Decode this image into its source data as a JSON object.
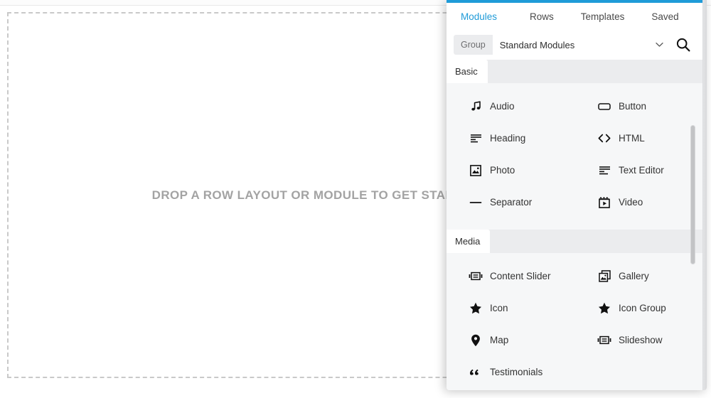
{
  "canvas": {
    "drop_text": "DROP A ROW LAYOUT OR MODULE TO GET STARTED"
  },
  "panel": {
    "accent_color": "#1f9bd8",
    "tabs": [
      {
        "label": "Modules",
        "active": true
      },
      {
        "label": "Rows",
        "active": false
      },
      {
        "label": "Templates",
        "active": false
      },
      {
        "label": "Saved",
        "active": false
      }
    ],
    "search": {
      "group_label": "Group",
      "selected_group": "Standard Modules",
      "search_icon": "search-icon",
      "chevron_icon": "chevron-down-icon"
    },
    "sections": [
      {
        "title": "Basic",
        "items": [
          {
            "label": "Audio",
            "icon": "music-note-icon"
          },
          {
            "label": "Button",
            "icon": "button-icon"
          },
          {
            "label": "Heading",
            "icon": "heading-lines-icon"
          },
          {
            "label": "HTML",
            "icon": "code-brackets-icon"
          },
          {
            "label": "Photo",
            "icon": "photo-icon"
          },
          {
            "label": "Text Editor",
            "icon": "text-lines-icon"
          },
          {
            "label": "Separator",
            "icon": "separator-dash-icon"
          },
          {
            "label": "Video",
            "icon": "video-clapper-icon"
          }
        ]
      },
      {
        "title": "Media",
        "items": [
          {
            "label": "Content Slider",
            "icon": "content-slider-icon"
          },
          {
            "label": "Gallery",
            "icon": "gallery-icon"
          },
          {
            "label": "Icon",
            "icon": "star-icon"
          },
          {
            "label": "Icon Group",
            "icon": "star-group-icon"
          },
          {
            "label": "Map",
            "icon": "map-pin-icon"
          },
          {
            "label": "Slideshow",
            "icon": "slideshow-icon"
          },
          {
            "label": "Testimonials",
            "icon": "quote-icon"
          }
        ]
      }
    ]
  }
}
